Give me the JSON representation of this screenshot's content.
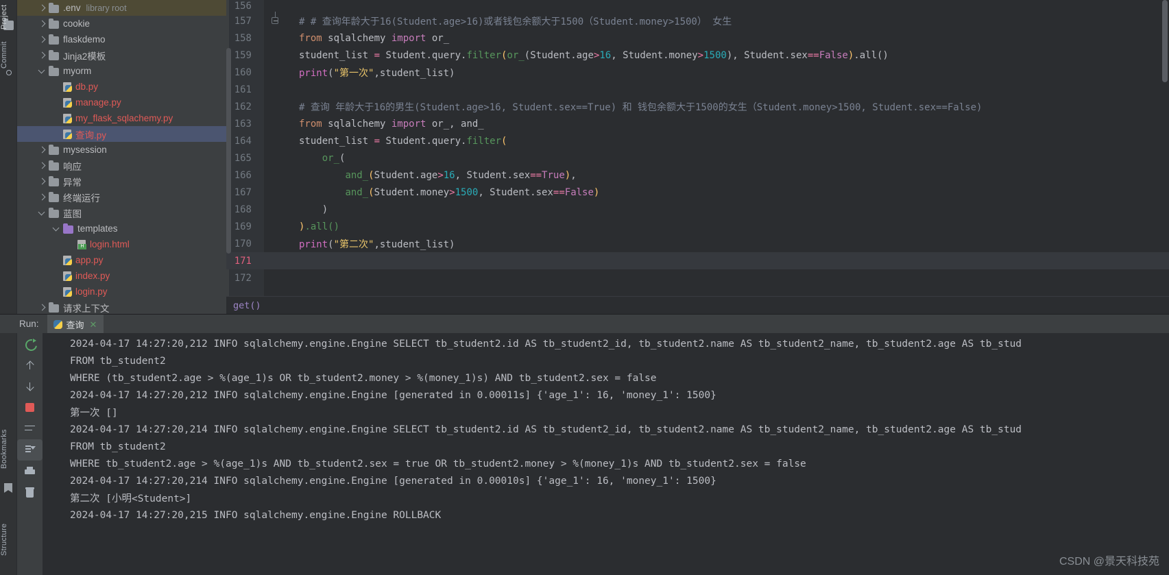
{
  "tool_strip": {
    "tabs": [
      {
        "label": "Project",
        "name": "tool-tab-project"
      },
      {
        "label": "Commit",
        "name": "tool-tab-commit"
      },
      {
        "label": "Bookmarks",
        "name": "tool-tab-bookmarks"
      },
      {
        "label": "Structure",
        "name": "tool-tab-structure"
      }
    ]
  },
  "tree": {
    "rows": [
      {
        "indent": 1,
        "chev": "right",
        "icon": "folder",
        "label": ".env",
        "suffix": "library root",
        "style": "folder",
        "state": "highlight"
      },
      {
        "indent": 1,
        "chev": "right",
        "icon": "folder",
        "label": "cookie",
        "suffix": "",
        "style": "folder",
        "state": ""
      },
      {
        "indent": 1,
        "chev": "right",
        "icon": "folder",
        "label": "flaskdemo",
        "suffix": "",
        "style": "folder",
        "state": ""
      },
      {
        "indent": 1,
        "chev": "right",
        "icon": "folder",
        "label": "Jinja2模板",
        "suffix": "",
        "style": "folder",
        "state": ""
      },
      {
        "indent": 1,
        "chev": "down",
        "icon": "folder",
        "label": "myorm",
        "suffix": "",
        "style": "folder",
        "state": ""
      },
      {
        "indent": 2,
        "chev": "none",
        "icon": "py",
        "label": "db.py",
        "suffix": "",
        "style": "py",
        "state": ""
      },
      {
        "indent": 2,
        "chev": "none",
        "icon": "py",
        "label": "manage.py",
        "suffix": "",
        "style": "py",
        "state": ""
      },
      {
        "indent": 2,
        "chev": "none",
        "icon": "py",
        "label": "my_flask_sqlachemy.py",
        "suffix": "",
        "style": "py",
        "state": ""
      },
      {
        "indent": 2,
        "chev": "none",
        "icon": "py",
        "label": "查询.py",
        "suffix": "",
        "style": "py",
        "state": "selected"
      },
      {
        "indent": 1,
        "chev": "right",
        "icon": "folder",
        "label": "mysession",
        "suffix": "",
        "style": "folder",
        "state": ""
      },
      {
        "indent": 1,
        "chev": "right",
        "icon": "folder",
        "label": "响应",
        "suffix": "",
        "style": "folder",
        "state": ""
      },
      {
        "indent": 1,
        "chev": "right",
        "icon": "folder",
        "label": "异常",
        "suffix": "",
        "style": "folder",
        "state": ""
      },
      {
        "indent": 1,
        "chev": "right",
        "icon": "folder",
        "label": "终端运行",
        "suffix": "",
        "style": "folder",
        "state": ""
      },
      {
        "indent": 1,
        "chev": "down",
        "icon": "folder",
        "label": "蓝图",
        "suffix": "",
        "style": "folder",
        "state": ""
      },
      {
        "indent": 2,
        "chev": "down",
        "icon": "folder-purple",
        "label": "templates",
        "suffix": "",
        "style": "folder",
        "state": ""
      },
      {
        "indent": 3,
        "chev": "none",
        "icon": "html",
        "label": "login.html",
        "suffix": "",
        "style": "py",
        "state": ""
      },
      {
        "indent": 2,
        "chev": "none",
        "icon": "py",
        "label": "app.py",
        "suffix": "",
        "style": "py",
        "state": ""
      },
      {
        "indent": 2,
        "chev": "none",
        "icon": "py",
        "label": "index.py",
        "suffix": "",
        "style": "py",
        "state": ""
      },
      {
        "indent": 2,
        "chev": "none",
        "icon": "py",
        "label": "login.py",
        "suffix": "",
        "style": "py",
        "state": ""
      },
      {
        "indent": 1,
        "chev": "right",
        "icon": "folder",
        "label": "请求上下文",
        "suffix": "",
        "style": "folder",
        "state": ""
      }
    ]
  },
  "editor": {
    "first_partial_line": "156",
    "current_line": "171",
    "lines": [
      {
        "no": "156",
        "fold": false,
        "tokens": []
      },
      {
        "no": "157",
        "fold": true,
        "tokens": [
          {
            "t": "# # 查询年龄大于16(Student.age>16)或者钱包余额大于1500（Student.money>1500） 女生",
            "c": "c-cmt"
          }
        ]
      },
      {
        "no": "158",
        "fold": false,
        "tokens": [
          {
            "t": "from",
            "c": "c-kw"
          },
          {
            "t": " sqlalchemy ",
            "c": "c-txt"
          },
          {
            "t": "import",
            "c": "c-kw2"
          },
          {
            "t": " or_",
            "c": "c-txt"
          }
        ]
      },
      {
        "no": "159",
        "fold": false,
        "tokens": [
          {
            "t": "student_list ",
            "c": "c-txt"
          },
          {
            "t": "=",
            "c": "c-pink"
          },
          {
            "t": " Student.query.",
            "c": "c-txt"
          },
          {
            "t": "filter",
            "c": "c-fn"
          },
          {
            "t": "(",
            "c": "c-par2"
          },
          {
            "t": "or_",
            "c": "c-fn"
          },
          {
            "t": "(",
            "c": "c-par1"
          },
          {
            "t": "Student.age",
            "c": "c-txt"
          },
          {
            "t": ">",
            "c": "c-pink"
          },
          {
            "t": "16",
            "c": "c-num"
          },
          {
            "t": ", Student.money",
            "c": "c-txt"
          },
          {
            "t": ">",
            "c": "c-pink"
          },
          {
            "t": "1500",
            "c": "c-num"
          },
          {
            "t": ")",
            "c": "c-par1"
          },
          {
            "t": ", Student.sex",
            "c": "c-txt"
          },
          {
            "t": "==",
            "c": "c-pink"
          },
          {
            "t": "False",
            "c": "c-const"
          },
          {
            "t": ")",
            "c": "c-par2"
          },
          {
            "t": ".all()",
            "c": "c-txt"
          }
        ]
      },
      {
        "no": "160",
        "fold": false,
        "tokens": [
          {
            "t": "print",
            "c": "c-magenta"
          },
          {
            "t": "(",
            "c": "c-txt"
          },
          {
            "t": "\"第一次\"",
            "c": "c-str2"
          },
          {
            "t": ",student_list)",
            "c": "c-txt"
          }
        ]
      },
      {
        "no": "161",
        "fold": false,
        "tokens": []
      },
      {
        "no": "162",
        "fold": false,
        "tokens": [
          {
            "t": "# 查询 年龄大于16的男生(Student.age>16, Student.sex==True) 和 钱包余额大于1500的女生（Student.money>1500, Student.sex==False)",
            "c": "c-cmt"
          }
        ]
      },
      {
        "no": "163",
        "fold": false,
        "tokens": [
          {
            "t": "from",
            "c": "c-kw"
          },
          {
            "t": " sqlalchemy ",
            "c": "c-txt"
          },
          {
            "t": "import",
            "c": "c-kw2"
          },
          {
            "t": " or_, and_",
            "c": "c-txt"
          }
        ]
      },
      {
        "no": "164",
        "fold": false,
        "tokens": [
          {
            "t": "student_list ",
            "c": "c-txt"
          },
          {
            "t": "=",
            "c": "c-pink"
          },
          {
            "t": " Student.query.",
            "c": "c-txt"
          },
          {
            "t": "filter",
            "c": "c-fn"
          },
          {
            "t": "(",
            "c": "c-par2"
          }
        ]
      },
      {
        "no": "165",
        "fold": false,
        "tokens": [
          {
            "t": "    ",
            "c": "c-txt"
          },
          {
            "t": "or_",
            "c": "c-fn"
          },
          {
            "t": "(",
            "c": "c-par1"
          }
        ]
      },
      {
        "no": "166",
        "fold": false,
        "tokens": [
          {
            "t": "        ",
            "c": "c-txt"
          },
          {
            "t": "and_",
            "c": "c-fn"
          },
          {
            "t": "(",
            "c": "c-par2"
          },
          {
            "t": "Student.age",
            "c": "c-txt"
          },
          {
            "t": ">",
            "c": "c-pink"
          },
          {
            "t": "16",
            "c": "c-num"
          },
          {
            "t": ", Student.sex",
            "c": "c-txt"
          },
          {
            "t": "==",
            "c": "c-pink"
          },
          {
            "t": "True",
            "c": "c-const"
          },
          {
            "t": ")",
            "c": "c-par2"
          },
          {
            "t": ",",
            "c": "c-txt"
          }
        ]
      },
      {
        "no": "167",
        "fold": false,
        "tokens": [
          {
            "t": "        ",
            "c": "c-txt"
          },
          {
            "t": "and_",
            "c": "c-fn"
          },
          {
            "t": "(",
            "c": "c-par2"
          },
          {
            "t": "Student.money",
            "c": "c-txt"
          },
          {
            "t": ">",
            "c": "c-pink"
          },
          {
            "t": "1500",
            "c": "c-num"
          },
          {
            "t": ", Student.sex",
            "c": "c-txt"
          },
          {
            "t": "==",
            "c": "c-pink"
          },
          {
            "t": "False",
            "c": "c-const"
          },
          {
            "t": ")",
            "c": "c-par2"
          }
        ]
      },
      {
        "no": "168",
        "fold": false,
        "tokens": [
          {
            "t": "    ",
            "c": "c-txt"
          },
          {
            "t": ")",
            "c": "c-par1"
          }
        ]
      },
      {
        "no": "169",
        "fold": false,
        "tokens": [
          {
            "t": ")",
            "c": "c-par2"
          },
          {
            "t": ".all()",
            "c": "c-fn"
          }
        ]
      },
      {
        "no": "170",
        "fold": false,
        "tokens": [
          {
            "t": "print",
            "c": "c-magenta"
          },
          {
            "t": "(",
            "c": "c-txt"
          },
          {
            "t": "\"第二次\"",
            "c": "c-str2"
          },
          {
            "t": ",student_list)",
            "c": "c-txt"
          }
        ]
      },
      {
        "no": "171",
        "fold": false,
        "tokens": []
      },
      {
        "no": "172",
        "fold": false,
        "tokens": []
      }
    ]
  },
  "breadcrumb": {
    "text": "get()"
  },
  "run_panel": {
    "label": "Run:",
    "tab_name": "查询",
    "close_label": "✕",
    "toolbar": [
      {
        "name": "rerun-button",
        "icon": "rerun",
        "active": false
      },
      {
        "name": "previous-occurrence-button",
        "icon": "arrow-up",
        "active": false
      },
      {
        "name": "next-occurrence-button",
        "icon": "arrow-down",
        "active": false
      },
      {
        "name": "stop-button",
        "icon": "stop",
        "active": false
      },
      {
        "name": "soft-wrap-button",
        "icon": "softwrap",
        "active": false
      },
      {
        "name": "scroll-to-end-button",
        "icon": "scrollend",
        "active": true
      },
      {
        "name": "print-button",
        "icon": "print",
        "active": false
      },
      {
        "name": "clear-all-button",
        "icon": "trash",
        "active": false
      }
    ],
    "output": [
      "2024-04-17 14:27:20,212 INFO sqlalchemy.engine.Engine SELECT tb_student2.id AS tb_student2_id, tb_student2.name AS tb_student2_name, tb_student2.age AS tb_stud",
      "FROM tb_student2",
      "WHERE (tb_student2.age > %(age_1)s OR tb_student2.money > %(money_1)s) AND tb_student2.sex = false",
      "2024-04-17 14:27:20,212 INFO sqlalchemy.engine.Engine [generated in 0.00011s] {'age_1': 16, 'money_1': 1500}",
      "第一次 []",
      "2024-04-17 14:27:20,214 INFO sqlalchemy.engine.Engine SELECT tb_student2.id AS tb_student2_id, tb_student2.name AS tb_student2_name, tb_student2.age AS tb_stud",
      "FROM tb_student2",
      "WHERE tb_student2.age > %(age_1)s AND tb_student2.sex = true OR tb_student2.money > %(money_1)s AND tb_student2.sex = false",
      "2024-04-17 14:27:20,214 INFO sqlalchemy.engine.Engine [generated in 0.00010s] {'age_1': 16, 'money_1': 1500}",
      "第二次 [小明<Student>]",
      "2024-04-17 14:27:20,215 INFO sqlalchemy.engine.Engine ROLLBACK"
    ]
  },
  "watermark": {
    "text": "CSDN @景天科技苑"
  }
}
